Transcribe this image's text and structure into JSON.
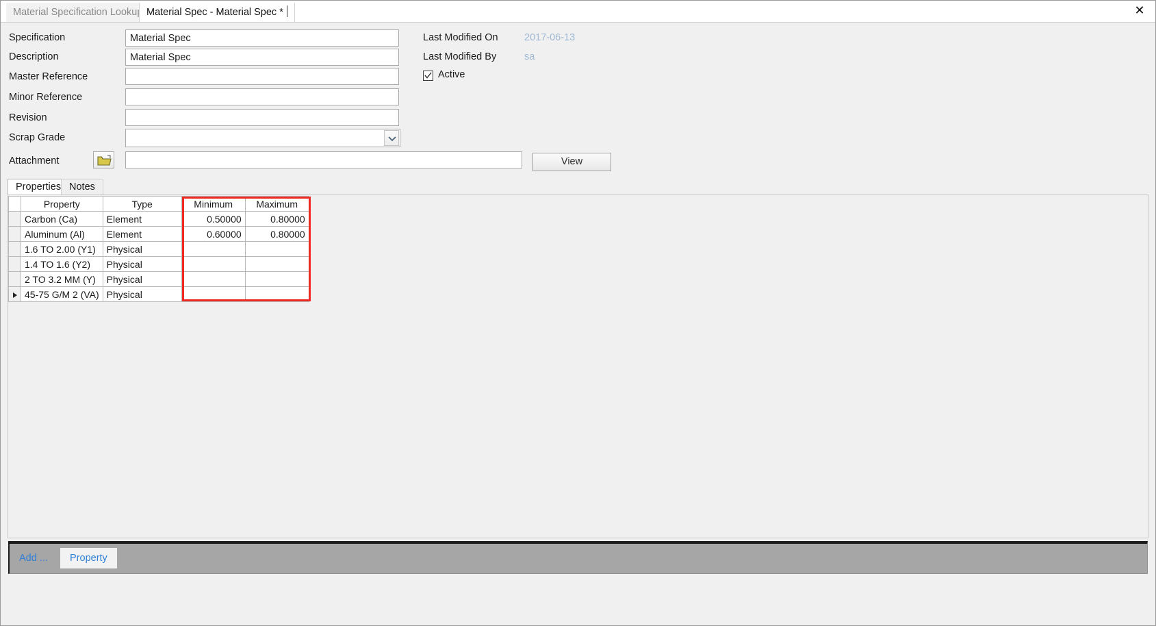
{
  "window": {
    "tabs": [
      {
        "label": "Material Specification Lookup",
        "active": false
      },
      {
        "label": "Material Spec - Material Spec *",
        "active": true
      }
    ],
    "close_icon": "close-icon",
    "close_glyph": "✕"
  },
  "form": {
    "fields": [
      {
        "label": "Specification",
        "value": "Material Spec",
        "placeholder": ""
      },
      {
        "label": "Description",
        "value": "Material Spec",
        "placeholder": ""
      },
      {
        "label": "Master Reference",
        "value": "",
        "placeholder": ""
      },
      {
        "label": "Minor Reference",
        "value": "",
        "placeholder": ""
      },
      {
        "label": "Revision",
        "value": "",
        "placeholder": ""
      }
    ],
    "scrap_grade": {
      "label": "Scrap Grade",
      "value": "",
      "placeholder": "",
      "icon": "chevron-down-icon"
    },
    "attachment": {
      "label": "Attachment",
      "value": "",
      "placeholder": "",
      "browse_icon": "open-folder-icon",
      "view_label": "View"
    },
    "meta": {
      "last_modified_on_label": "Last Modified On",
      "last_modified_on_value": "2017-06-13",
      "last_modified_by_label": "Last Modified By",
      "last_modified_by_value": "sa",
      "active_label": "Active",
      "active_checked": true,
      "check_icon": "checkmark-icon"
    }
  },
  "inner_tabs": [
    {
      "label": "Properties",
      "selected": true
    },
    {
      "label": "Notes",
      "selected": false
    }
  ],
  "grid": {
    "columns": [
      "Property",
      "Type",
      "Minimum",
      "Maximum"
    ],
    "rows": [
      {
        "selected": false,
        "property": "Carbon (Ca)",
        "type": "Element",
        "minimum": "0.50000",
        "maximum": "0.80000"
      },
      {
        "selected": false,
        "property": "Aluminum (Al)",
        "type": "Element",
        "minimum": "0.60000",
        "maximum": "0.80000"
      },
      {
        "selected": false,
        "property": "1.6 TO 2.00 (Y1)",
        "type": "Physical",
        "minimum": "",
        "maximum": ""
      },
      {
        "selected": false,
        "property": "1.4 TO 1.6 (Y2)",
        "type": "Physical",
        "minimum": "",
        "maximum": ""
      },
      {
        "selected": false,
        "property": "2 TO 3.2 MM (Y)",
        "type": "Physical",
        "minimum": "",
        "maximum": ""
      },
      {
        "selected": true,
        "property": "45-75 G/M 2 (VA)",
        "type": "Physical",
        "minimum": "",
        "maximum": ""
      }
    ],
    "highlight_color": "#ee2a22"
  },
  "bottom_bar": {
    "add_label": "Add ...",
    "property_label": "Property",
    "accent_color": "#2f7fd8",
    "background_color": "#a6a6a6"
  }
}
